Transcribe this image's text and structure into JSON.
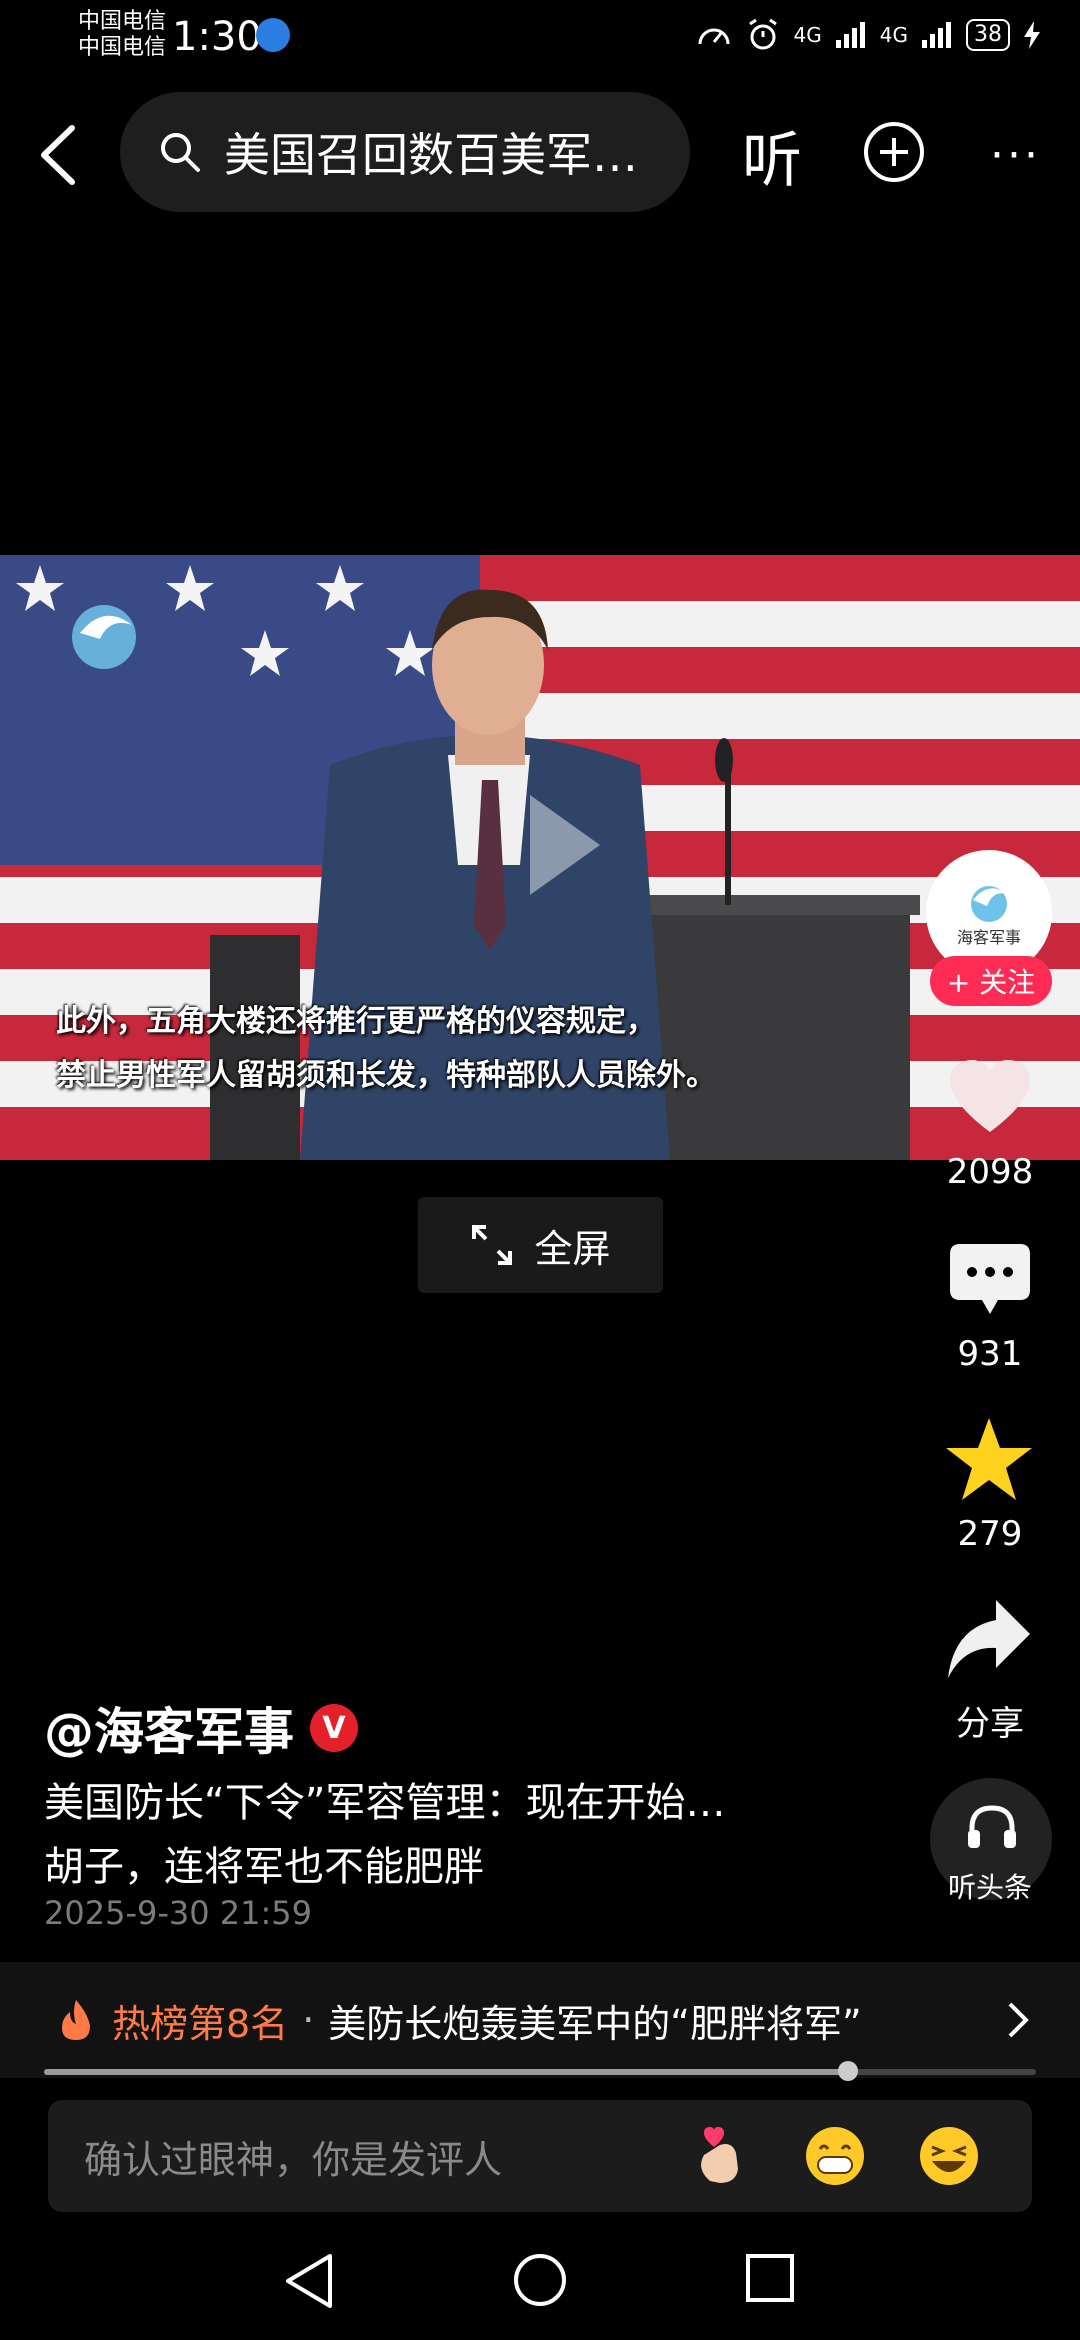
{
  "status_bar": {
    "carrier_1": "中国电信",
    "carrier_2": "中国电信",
    "time": "1:30",
    "network_1": "4G",
    "network_2": "4G",
    "battery": "38"
  },
  "top_bar": {
    "search_text": "美国召回数百美军…",
    "listen_label": "听"
  },
  "video": {
    "subtitle_line1": "此外，五角大楼还将推行更严格的仪容规定，",
    "subtitle_line2": "禁止男性军人留胡须和长发，特种部队人员除外。",
    "fullscreen_label": "全屏"
  },
  "side_actions": {
    "avatar_text": "海客军事",
    "follow_label": "+ 关注",
    "likes": "2098",
    "comments": "931",
    "favorites": "279",
    "share_label": "分享",
    "listen_label": "听头条"
  },
  "post": {
    "author": "@海客军事",
    "verified_badge": "V",
    "title_line1": "美国防长“下令”军容管理：现在开始…",
    "title_line2": "胡子，连将军也不能肥胖",
    "date": "2025-9-30 21:59"
  },
  "hot_list": {
    "rank_label": "热榜第8名",
    "separator": "·",
    "headline": "美防长炮轰美军中的“肥胖将军”"
  },
  "progress": {
    "played_fraction": 0.81
  },
  "comment_bar": {
    "placeholder": "确认过眼神，你是发评人"
  },
  "colors": {
    "accent_red": "#fe2c55",
    "hot_orange": "#ff7a45",
    "star_yellow": "#ffd21e"
  }
}
